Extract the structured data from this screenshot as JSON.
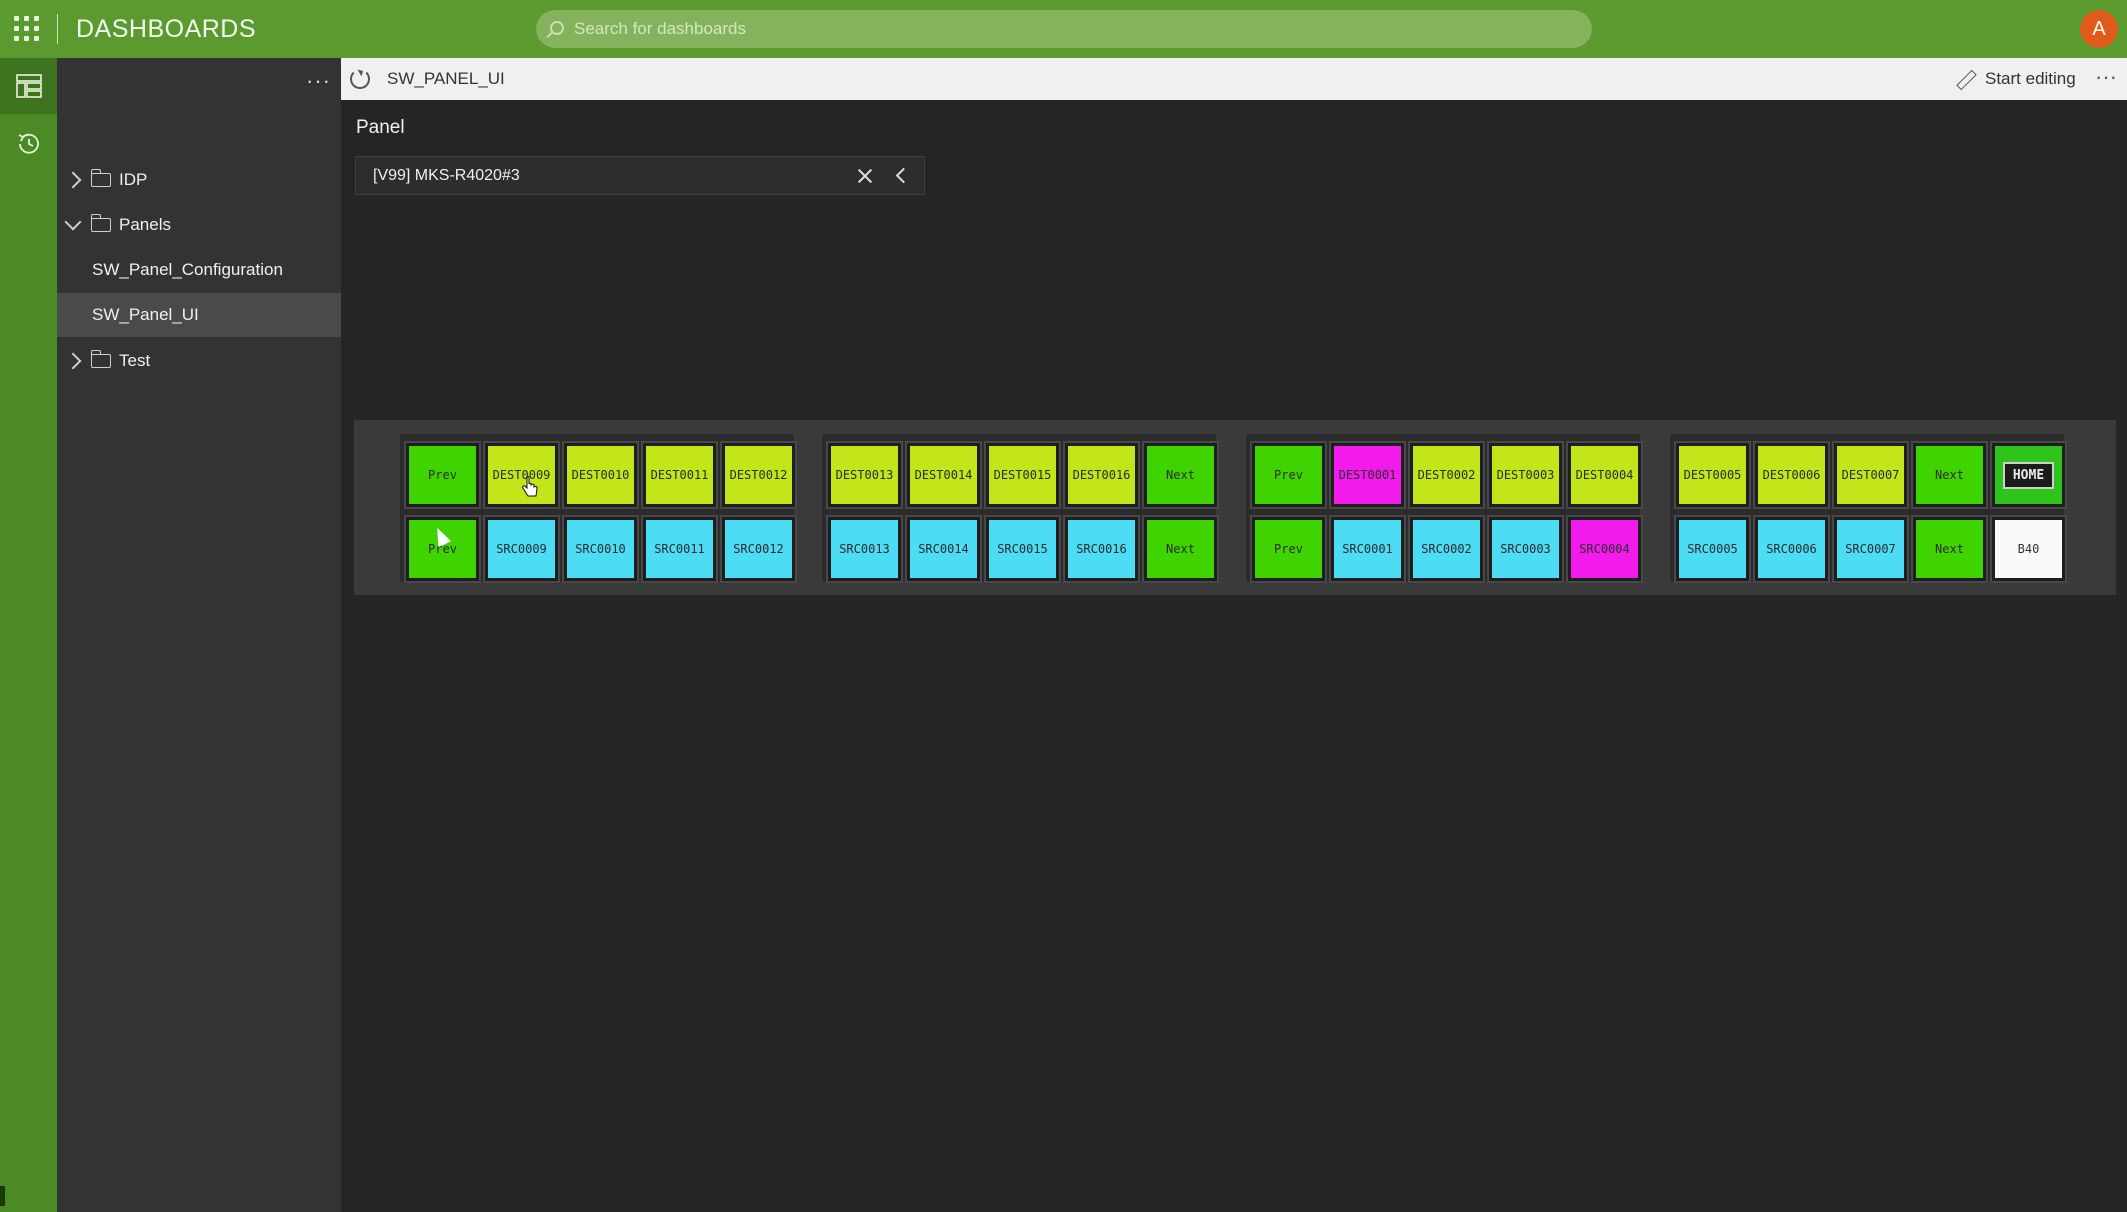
{
  "topbar": {
    "title": "DASHBOARDS",
    "search_placeholder": "Search for dashboards",
    "avatar_initial": "A",
    "brand_color": "#5a9a2e"
  },
  "rail": {
    "items": [
      {
        "icon": "dashboard-tree-icon",
        "active": true
      },
      {
        "icon": "history-icon",
        "active": false
      }
    ]
  },
  "tree": {
    "more_label": "···",
    "items": [
      {
        "label": "IDP",
        "type": "folder",
        "expanded": false
      },
      {
        "label": "Panels",
        "type": "folder",
        "expanded": true
      },
      {
        "label": "SW_Panel_Configuration",
        "type": "dashboard"
      },
      {
        "label": "SW_Panel_UI",
        "type": "dashboard",
        "selected": true
      },
      {
        "label": "Test",
        "type": "folder",
        "expanded": false
      }
    ]
  },
  "header": {
    "dashboard_name": "SW_PANEL_UI",
    "edit_label": "Start editing",
    "more_label": "···"
  },
  "panel": {
    "title": "Panel",
    "selected_device": "[V99] MKS-R4020#3"
  },
  "keys": {
    "group1": {
      "top": [
        {
          "label": "Prev",
          "color": "green"
        },
        {
          "label": "DEST0009",
          "color": "lime"
        },
        {
          "label": "DEST0010",
          "color": "lime"
        },
        {
          "label": "DEST0011",
          "color": "lime"
        },
        {
          "label": "DEST0012",
          "color": "lime"
        }
      ],
      "bottom": [
        {
          "label": "Prev",
          "color": "green"
        },
        {
          "label": "SRC0009",
          "color": "cyan"
        },
        {
          "label": "SRC0010",
          "color": "cyan"
        },
        {
          "label": "SRC0011",
          "color": "cyan"
        },
        {
          "label": "SRC0012",
          "color": "cyan"
        }
      ]
    },
    "group2": {
      "top": [
        {
          "label": "DEST0013",
          "color": "lime"
        },
        {
          "label": "DEST0014",
          "color": "lime"
        },
        {
          "label": "DEST0015",
          "color": "lime"
        },
        {
          "label": "DEST0016",
          "color": "lime"
        },
        {
          "label": "Next",
          "color": "green"
        }
      ],
      "bottom": [
        {
          "label": "SRC0013",
          "color": "cyan"
        },
        {
          "label": "SRC0014",
          "color": "cyan"
        },
        {
          "label": "SRC0015",
          "color": "cyan"
        },
        {
          "label": "SRC0016",
          "color": "cyan"
        },
        {
          "label": "Next",
          "color": "green"
        }
      ]
    },
    "group3": {
      "top": [
        {
          "label": "Prev",
          "color": "green"
        },
        {
          "label": "DEST0001",
          "color": "magenta"
        },
        {
          "label": "DEST0002",
          "color": "lime"
        },
        {
          "label": "DEST0003",
          "color": "lime"
        },
        {
          "label": "DEST0004",
          "color": "lime"
        }
      ],
      "bottom": [
        {
          "label": "Prev",
          "color": "green"
        },
        {
          "label": "SRC0001",
          "color": "cyan"
        },
        {
          "label": "SRC0002",
          "color": "cyan"
        },
        {
          "label": "SRC0003",
          "color": "cyan"
        },
        {
          "label": "SRC0004",
          "color": "magenta"
        }
      ]
    },
    "group4": {
      "top": [
        {
          "label": "DEST0005",
          "color": "lime"
        },
        {
          "label": "DEST0006",
          "color": "lime"
        },
        {
          "label": "DEST0007",
          "color": "lime"
        },
        {
          "label": "Next",
          "color": "green"
        },
        {
          "label": "HOME",
          "color": "home"
        }
      ],
      "bottom": [
        {
          "label": "SRC0005",
          "color": "cyan"
        },
        {
          "label": "SRC0006",
          "color": "cyan"
        },
        {
          "label": "SRC0007",
          "color": "cyan"
        },
        {
          "label": "Next",
          "color": "green"
        },
        {
          "label": "B40",
          "color": "white"
        }
      ]
    },
    "colors": {
      "green": "#3fd400",
      "lime": "#c2e619",
      "cyan": "#4cdcf4",
      "magenta": "#f21bec",
      "white": "#fafafa"
    }
  }
}
